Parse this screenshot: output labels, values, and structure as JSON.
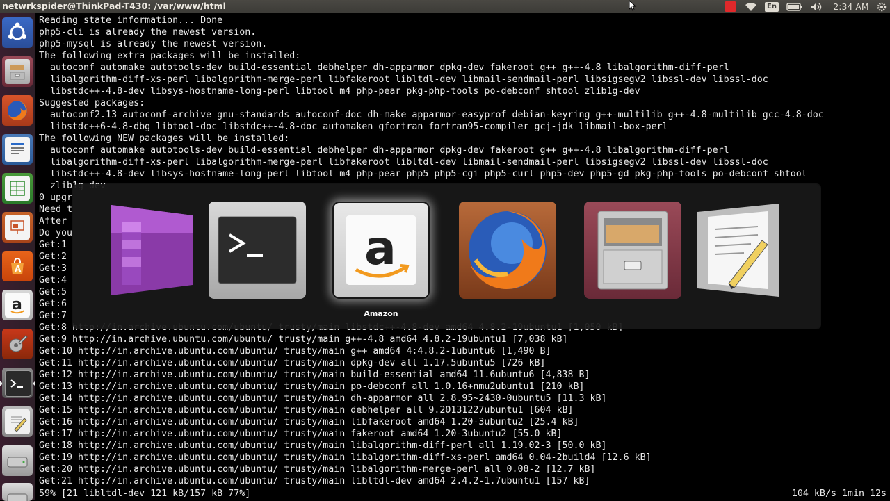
{
  "topbar": {
    "window_title": "netwrkspider@ThinkPad-T430: /var/www/html",
    "keyboard_layout": "En",
    "time": "2:34 AM",
    "indicators": [
      "red-square-icon",
      "wifi-icon",
      "keyboard-en",
      "battery-icon",
      "volume-icon",
      "clock",
      "power-gear-icon"
    ]
  },
  "launcher": {
    "items": [
      {
        "name": "dash-home",
        "icon": "ubuntu-logo-icon"
      },
      {
        "name": "files",
        "icon": "file-cabinet-icon"
      },
      {
        "name": "firefox",
        "icon": "firefox-icon"
      },
      {
        "name": "libreoffice-writer",
        "icon": "writer-icon"
      },
      {
        "name": "libreoffice-calc",
        "icon": "calc-icon"
      },
      {
        "name": "libreoffice-impress",
        "icon": "impress-icon"
      },
      {
        "name": "software-center",
        "icon": "shopping-bag-icon"
      },
      {
        "name": "amazon",
        "icon": "amazon-icon"
      },
      {
        "name": "system-settings",
        "icon": "settings-wrench-icon"
      },
      {
        "name": "terminal",
        "icon": "terminal-icon"
      },
      {
        "name": "text-editor",
        "icon": "text-editor-icon"
      },
      {
        "name": "drive",
        "icon": "drive-icon"
      }
    ]
  },
  "terminal": {
    "lines": [
      "Reading state information... Done",
      "php5-cli is already the newest version.",
      "php5-mysql is already the newest version.",
      "The following extra packages will be installed:",
      "  autoconf automake autotools-dev build-essential debhelper dh-apparmor dpkg-dev fakeroot g++ g++-4.8 libalgorithm-diff-perl",
      "  libalgorithm-diff-xs-perl libalgorithm-merge-perl libfakeroot libltdl-dev libmail-sendmail-perl libsigsegv2 libssl-dev libssl-doc",
      "  libstdc++-4.8-dev libsys-hostname-long-perl libtool m4 php-pear pkg-php-tools po-debconf shtool zlib1g-dev",
      "Suggested packages:",
      "  autoconf2.13 autoconf-archive gnu-standards autoconf-doc dh-make apparmor-easyprof debian-keyring g++-multilib g++-4.8-multilib gcc-4.8-doc",
      "  libstdc++6-4.8-dbg libtool-doc libstdc++-4.8-doc automaken gfortran fortran95-compiler gcj-jdk libmail-box-perl",
      "The following NEW packages will be installed:",
      "  autoconf automake autotools-dev build-essential debhelper dh-apparmor dpkg-dev fakeroot g++ g++-4.8 libalgorithm-diff-perl",
      "  libalgorithm-diff-xs-perl libalgorithm-merge-perl libfakeroot libltdl-dev libmail-sendmail-perl libsigsegv2 libssl-dev libssl-doc",
      "  libstdc++-4.8-dev libsys-hostname-long-perl libtool m4 php-pear php5 php5-cgi php5-curl php5-dev php5-gd pkg-php-tools po-debconf shtool",
      "  zlib1g-dev",
      "0 upgr",
      "Need t",
      "After",
      "Do you",
      "Get:1",
      "Get:2",
      "Get:3",
      "Get:4",
      "Get:5",
      "Get:6",
      "Get:7",
      "Get:8 http://in.archive.ubuntu.com/ubuntu/ trusty/main libstdc++-4.8-dev amd64 4.8.2-19ubuntu1 [1,050 kB]",
      "Get:9 http://in.archive.ubuntu.com/ubuntu/ trusty/main g++-4.8 amd64 4.8.2-19ubuntu1 [7,038 kB]",
      "Get:10 http://in.archive.ubuntu.com/ubuntu/ trusty/main g++ amd64 4:4.8.2-1ubuntu6 [1,490 B]",
      "Get:11 http://in.archive.ubuntu.com/ubuntu/ trusty/main dpkg-dev all 1.17.5ubuntu5 [726 kB]",
      "Get:12 http://in.archive.ubuntu.com/ubuntu/ trusty/main build-essential amd64 11.6ubuntu6 [4,838 B]",
      "Get:13 http://in.archive.ubuntu.com/ubuntu/ trusty/main po-debconf all 1.0.16+nmu2ubuntu1 [210 kB]",
      "Get:14 http://in.archive.ubuntu.com/ubuntu/ trusty/main dh-apparmor all 2.8.95~2430-0ubuntu5 [11.3 kB]",
      "Get:15 http://in.archive.ubuntu.com/ubuntu/ trusty/main debhelper all 9.20131227ubuntu1 [604 kB]",
      "Get:16 http://in.archive.ubuntu.com/ubuntu/ trusty/main libfakeroot amd64 1.20-3ubuntu2 [25.4 kB]",
      "Get:17 http://in.archive.ubuntu.com/ubuntu/ trusty/main fakeroot amd64 1.20-3ubuntu2 [55.0 kB]",
      "Get:18 http://in.archive.ubuntu.com/ubuntu/ trusty/main libalgorithm-diff-perl all 1.19.02-3 [50.0 kB]",
      "Get:19 http://in.archive.ubuntu.com/ubuntu/ trusty/main libalgorithm-diff-xs-perl amd64 0.04-2build4 [12.6 kB]",
      "Get:20 http://in.archive.ubuntu.com/ubuntu/ trusty/main libalgorithm-merge-perl all 0.08-2 [12.7 kB]",
      "Get:21 http://in.archive.ubuntu.com/ubuntu/ trusty/main libltdl-dev amd64 2.4.2-1.7ubuntu1 [157 kB]"
    ],
    "status_left": "59% [21 libltdl-dev 121 kB/157 kB 77%]",
    "status_right": "104 kB/s 1min 12s"
  },
  "switcher": {
    "selected_label": "Amazon",
    "apps": [
      {
        "name": "Workspace Switcher",
        "icon": "workspace-switcher-icon"
      },
      {
        "name": "Terminal",
        "icon": "terminal-icon"
      },
      {
        "name": "Amazon",
        "icon": "amazon-icon"
      },
      {
        "name": "Firefox",
        "icon": "firefox-icon"
      },
      {
        "name": "Files",
        "icon": "file-cabinet-icon"
      },
      {
        "name": "Text Editor",
        "icon": "text-editor-icon"
      }
    ]
  },
  "colors": {
    "panel": "#3c3b37",
    "launcher": "#2d1f28",
    "terminal_bg": "#000000",
    "terminal_fg": "#e8e8e8",
    "amazon_orange": "#f29a1f"
  }
}
